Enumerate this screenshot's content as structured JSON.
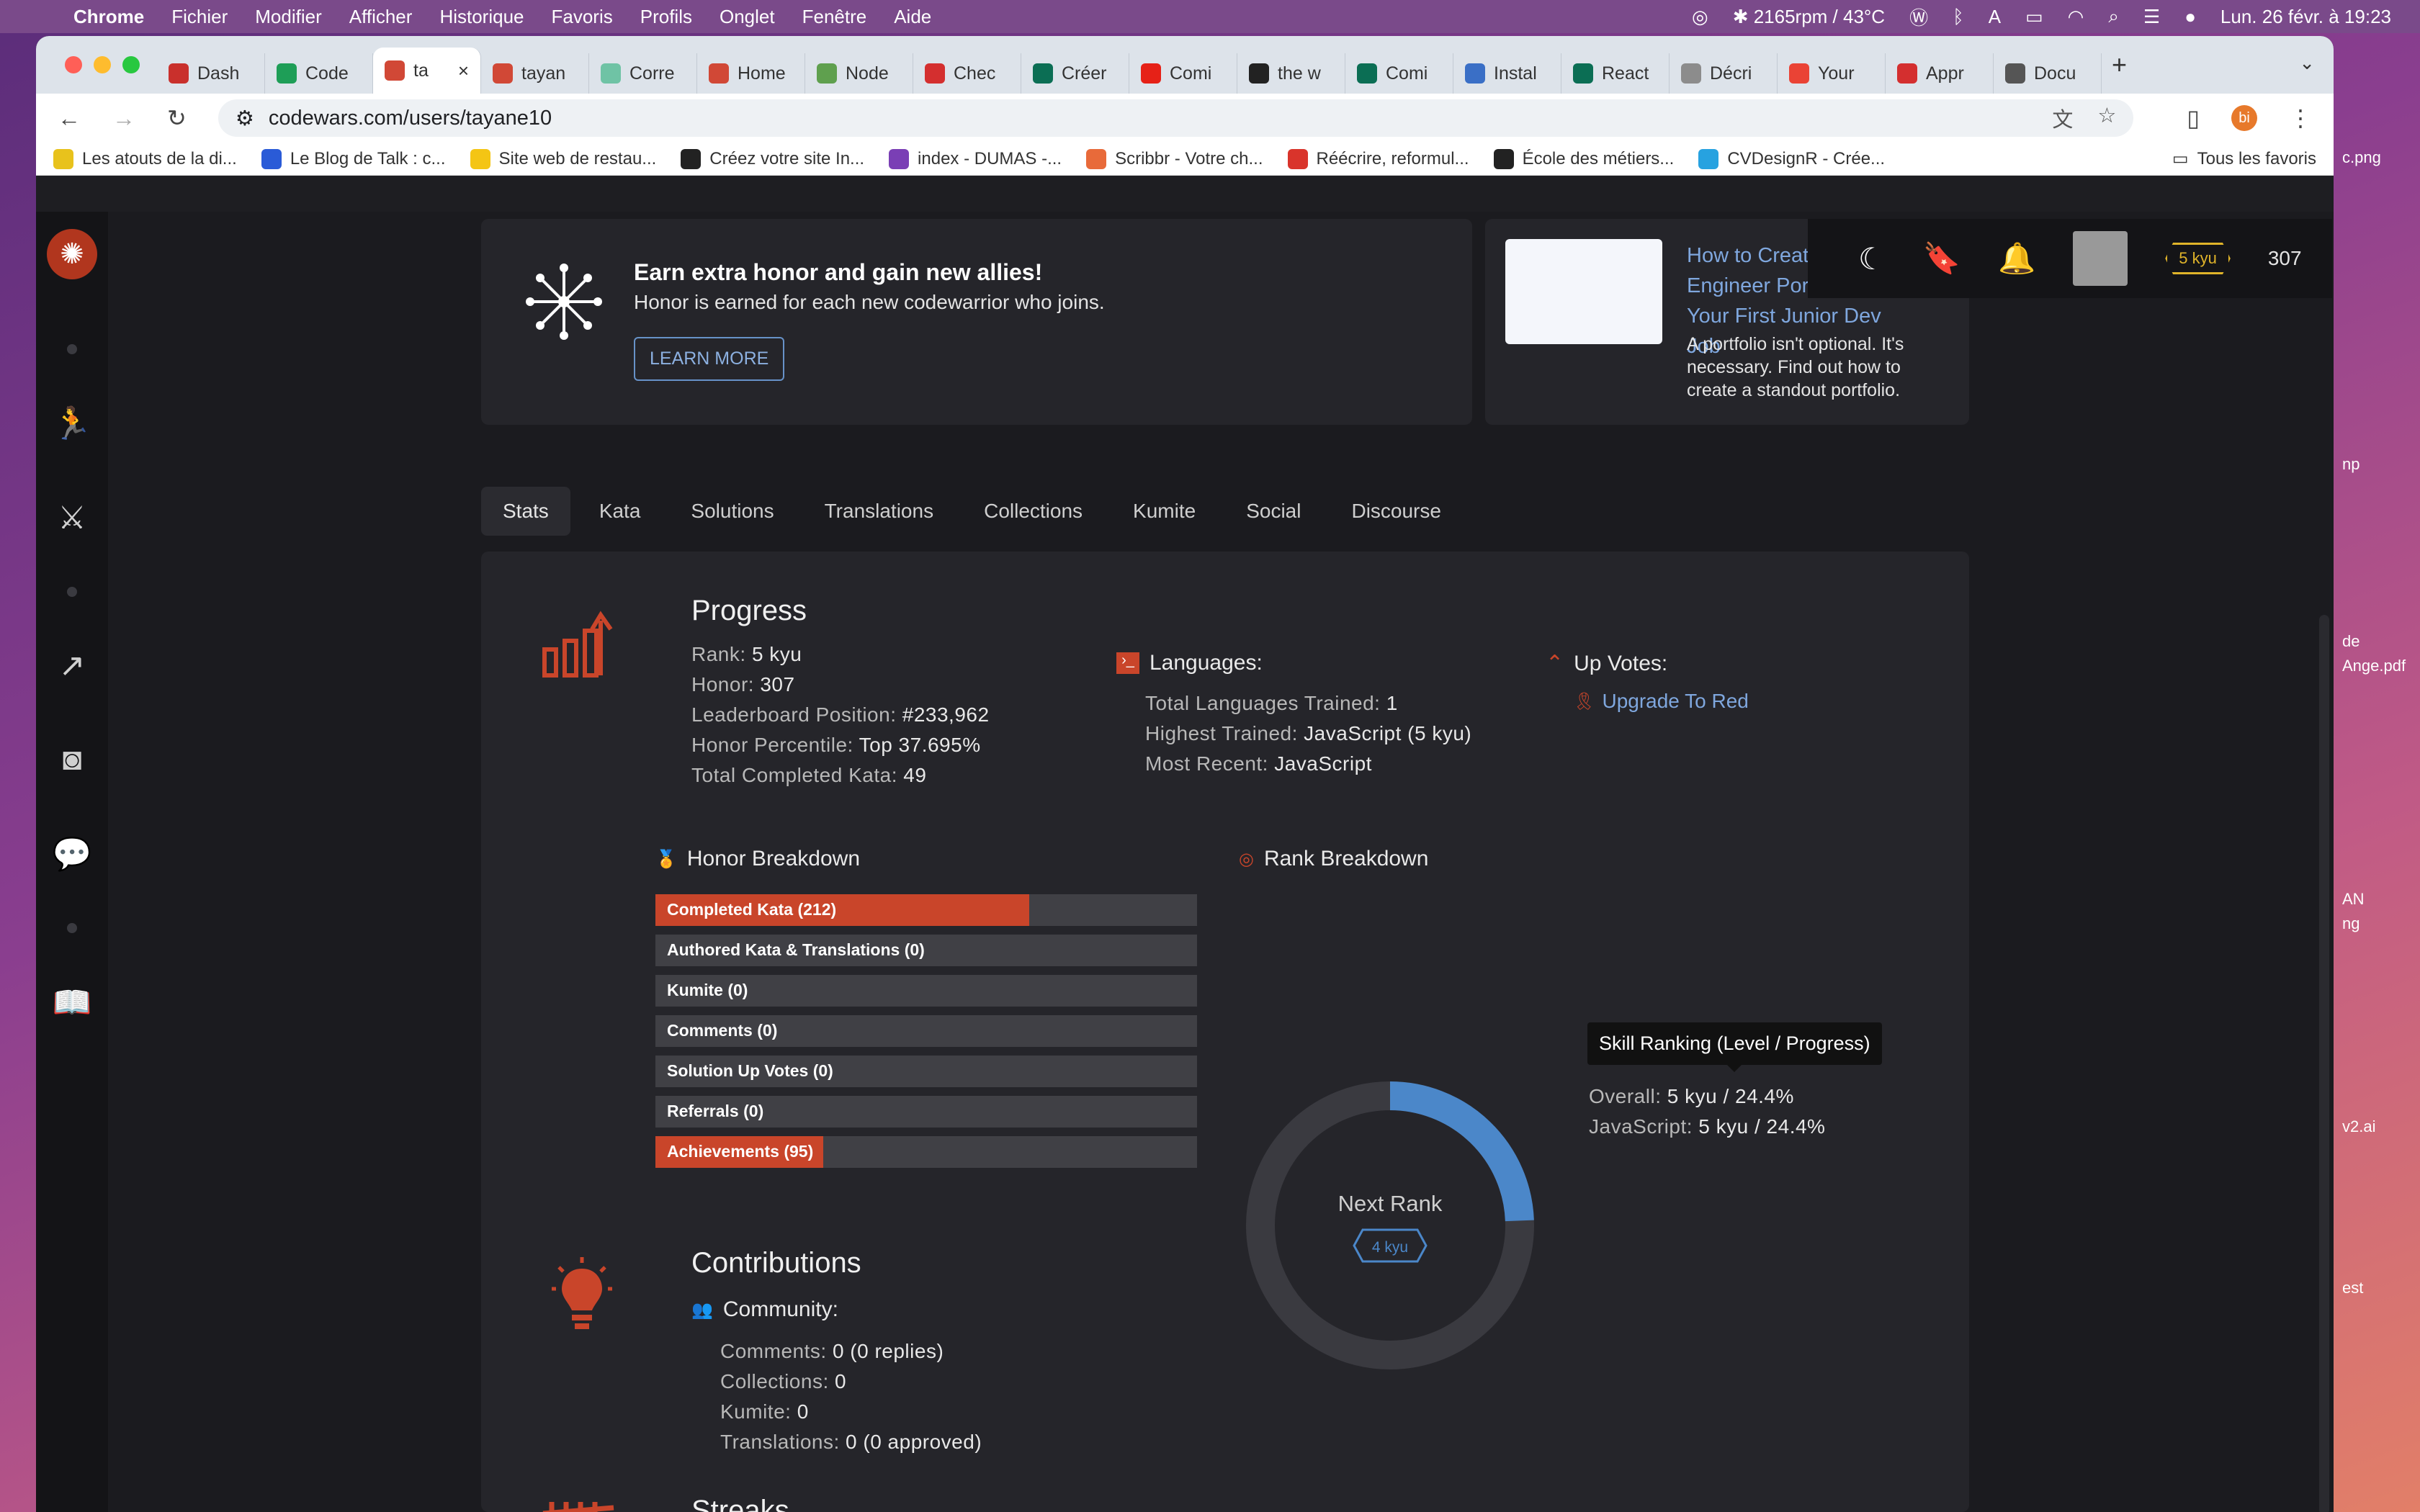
{
  "menubar": {
    "items": [
      "Chrome",
      "Fichier",
      "Modifier",
      "Afficher",
      "Historique",
      "Favoris",
      "Profils",
      "Onglet",
      "Fenêtre",
      "Aide"
    ],
    "status_fan": "2165rpm / 43°C",
    "clock": "Lun. 26 févr. à 19:23"
  },
  "tabs": [
    {
      "label": "Dash",
      "color": "#c9302c"
    },
    {
      "label": "Code",
      "color": "#1e9e57"
    },
    {
      "label": "ta",
      "color": "#d14836",
      "active": true
    },
    {
      "label": "tayan",
      "color": "#d14836"
    },
    {
      "label": "Corre",
      "color": "#6fc3a5"
    },
    {
      "label": "Home",
      "color": "#d14836"
    },
    {
      "label": "Node",
      "color": "#5fa04e"
    },
    {
      "label": "Chec",
      "color": "#d42f2f"
    },
    {
      "label": "Créer",
      "color": "#0b6e54"
    },
    {
      "label": "Comi",
      "color": "#e62117"
    },
    {
      "label": "the w",
      "color": "#222"
    },
    {
      "label": "Comi",
      "color": "#0b6e54"
    },
    {
      "label": "Instal",
      "color": "#3a6fc6"
    },
    {
      "label": "React",
      "color": "#0b6e54"
    },
    {
      "label": "Décri",
      "color": "#8c8c8c"
    },
    {
      "label": "Your",
      "color": "#ea4335"
    },
    {
      "label": "Appr",
      "color": "#d42f2f"
    },
    {
      "label": "Docu",
      "color": "#555"
    }
  ],
  "url": "codewars.com/users/tayane10",
  "profile_initials": "bi",
  "bookmarks": [
    {
      "label": "Les atouts de la di...",
      "color": "#e8c21c"
    },
    {
      "label": "Le Blog de Talk : c...",
      "color": "#2a5bd7"
    },
    {
      "label": "Site web de restau...",
      "color": "#f4c514"
    },
    {
      "label": "Créez votre site In...",
      "color": "#222"
    },
    {
      "label": "index - DUMAS -...",
      "color": "#7a3fb5"
    },
    {
      "label": "Scribbr - Votre ch...",
      "color": "#e86a3a"
    },
    {
      "label": "Réécrire, reformul...",
      "color": "#d9342b"
    },
    {
      "label": "École des métiers...",
      "color": "#222"
    },
    {
      "label": "CVDesignR - Crée...",
      "color": "#27a2e0"
    }
  ],
  "bookmarks_all": "Tous les favoris",
  "banner": {
    "title": "Earn extra honor and gain new allies!",
    "subtitle": "Honor is earned for each new codewarrior who joins.",
    "button": "LEARN MORE"
  },
  "promo": {
    "title_lines": [
      "How to Create a",
      "Engineer Portfo",
      "Your First Junior Dev Job"
    ],
    "description": "A portfolio isn't optional. It's necessary. Find out how to create a standout portfolio."
  },
  "user_header": {
    "rank_badge": "5 kyu",
    "honor": "307"
  },
  "profile_tabs": [
    "Stats",
    "Kata",
    "Solutions",
    "Translations",
    "Collections",
    "Kumite",
    "Social",
    "Discourse"
  ],
  "progress": {
    "title": "Progress",
    "stats": [
      {
        "k": "Rank:",
        "v": "5 kyu"
      },
      {
        "k": "Honor:",
        "v": "307"
      },
      {
        "k": "Leaderboard Position:",
        "v": "#233,962"
      },
      {
        "k": "Honor Percentile:",
        "v": "Top 37.695%"
      },
      {
        "k": "Total Completed Kata:",
        "v": "49"
      }
    ],
    "languages_title": "Languages:",
    "languages": [
      {
        "k": "Total Languages Trained:",
        "v": "1"
      },
      {
        "k": "Highest Trained:",
        "v": "JavaScript (5 kyu)"
      },
      {
        "k": "Most Recent:",
        "v": "JavaScript"
      }
    ],
    "upvotes_title": "Up Votes:",
    "upgrade_link": "Upgrade To Red"
  },
  "honor_breakdown": {
    "title": "Honor Breakdown",
    "rows": [
      {
        "label": "Completed Kata (212)",
        "fraction": 0.69
      },
      {
        "label": "Authored Kata & Translations (0)",
        "fraction": 0
      },
      {
        "label": "Kumite (0)",
        "fraction": 0
      },
      {
        "label": "Comments (0)",
        "fraction": 0
      },
      {
        "label": "Solution Up Votes (0)",
        "fraction": 0
      },
      {
        "label": "Referrals (0)",
        "fraction": 0
      },
      {
        "label": "Achievements (95)",
        "fraction": 0.31
      }
    ]
  },
  "rank_breakdown": {
    "title": "Rank Breakdown",
    "center_label": "Next Rank",
    "next_rank": "4 kyu",
    "progress_fraction": 0.244,
    "tooltip": "Skill Ranking (Level / Progress)",
    "skills": [
      {
        "k": "Overall:",
        "v": "5 kyu / 24.4%"
      },
      {
        "k": "JavaScript:",
        "v": "5 kyu / 24.4%"
      }
    ]
  },
  "contributions": {
    "title": "Contributions",
    "community_title": "Community:",
    "stats": [
      {
        "k": "Comments:",
        "v": "0 (0 replies)"
      },
      {
        "k": "Collections:",
        "v": "0"
      },
      {
        "k": "Kumite:",
        "v": "0"
      },
      {
        "k": "Translations:",
        "v": "0 (0 approved)"
      }
    ]
  },
  "streaks": {
    "title": "Streaks"
  },
  "desktop_items": [
    "c.png",
    "np",
    "de",
    "Ange.pdf",
    "AN",
    "ng",
    "v2.ai",
    "est"
  ]
}
